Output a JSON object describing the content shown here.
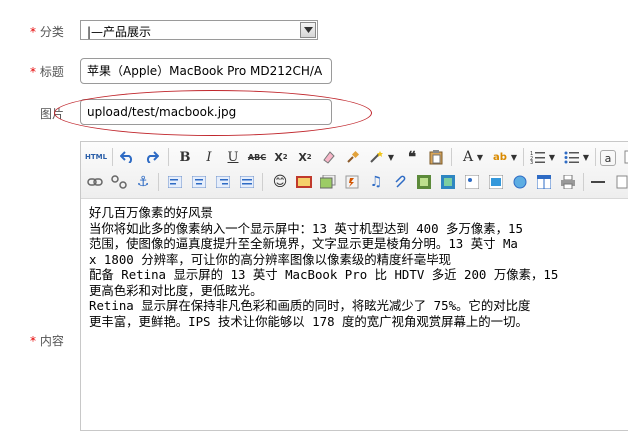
{
  "form": {
    "category": {
      "required_mark": "*",
      "label": "分类",
      "value": "|—产品展示"
    },
    "title": {
      "required_mark": "*",
      "label": "标题",
      "value": "苹果（Apple）MacBook Pro MD212CH/A"
    },
    "image": {
      "label": "图片",
      "value": "upload/test/macbook.jpg"
    },
    "content": {
      "required_mark": "*",
      "label": "内容"
    }
  },
  "toolbar": {
    "html_label": "HTML"
  },
  "editor": {
    "lines": [
      "好几百万像素的好风景",
      "当你将如此多的像素纳入一个显示屏中：13 英寸机型达到 400 多万像素，15",
      "范围，使图像的逼真度提升至全新境界，文字显示更是棱角分明。13 英寸 Ma",
      "x 1800 分辨率，可让你的高分辨率图像以像素级的精度纤毫毕现",
      "配备 Retina 显示屏的 13 英寸 MacBook Pro 比 HDTV 多近 200 万像素，15",
      "更高色彩和对比度，更低眩光。",
      "Retina 显示屏在保持非凡色彩和画质的同时，将眩光减少了 75%。它的对比度",
      "更丰富，更鲜艳。IPS 技术让你能够以 178 度的宽广视角观赏屏幕上的一切。"
    ]
  },
  "colors": {
    "required": "#e60000",
    "highlight_ellipse": "#c0272d"
  }
}
